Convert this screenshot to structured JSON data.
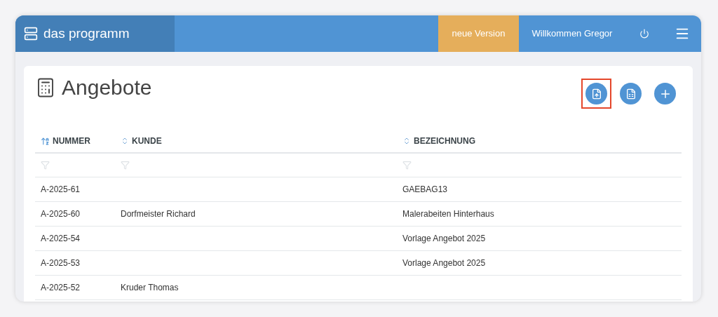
{
  "header": {
    "brand": "das programm",
    "badge": "neue Version",
    "welcome": "Willkommen Gregor"
  },
  "page": {
    "title": "Angebote",
    "actions": [
      {
        "kind": "upload",
        "highlighted": true
      },
      {
        "kind": "excel",
        "highlighted": false
      },
      {
        "kind": "add",
        "highlighted": false
      }
    ]
  },
  "table": {
    "columns": [
      {
        "label": "NUMMER",
        "sorted": true
      },
      {
        "label": "KUNDE",
        "sorted": false
      },
      {
        "label": "BEZEICHNUNG",
        "sorted": false
      }
    ],
    "rows": [
      [
        "A-2025-61",
        "",
        "GAEBAG13"
      ],
      [
        "A-2025-60",
        "Dorfmeister Richard",
        "Malerabeiten Hinterhaus"
      ],
      [
        "A-2025-54",
        "",
        "Vorlage Angebot 2025"
      ],
      [
        "A-2025-53",
        "",
        "Vorlage Angebot 2025"
      ],
      [
        "A-2025-52",
        "Kruder Thomas",
        ""
      ]
    ]
  }
}
